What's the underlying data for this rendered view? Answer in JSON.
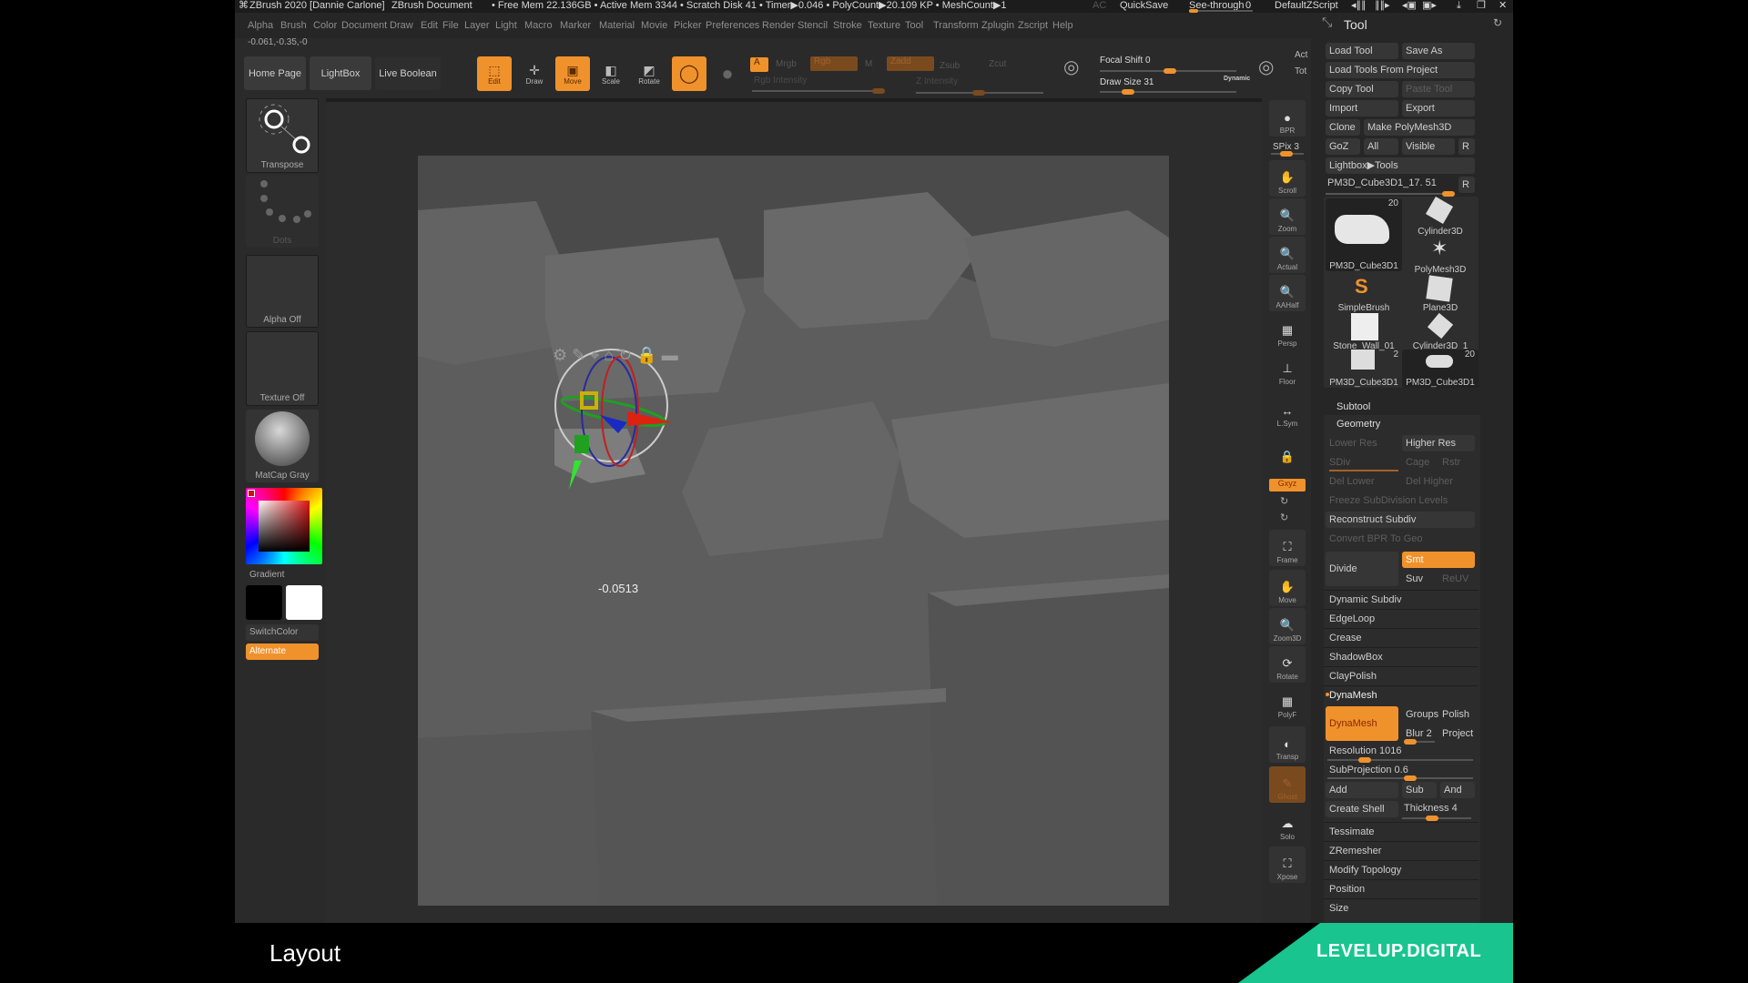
{
  "titlebar": {
    "app": "ZBrush 2020 [Dannie Carlone]",
    "document": "ZBrush Document",
    "stats": "• Free Mem 22.136GB • Active Mem 3344 • Scratch Disk 41 • Timer▶0.046 • PolyCount▶20.109 KP • MeshCount▶1",
    "ac": "AC",
    "quicksave": "QuickSave",
    "seethrough_label": "See-through",
    "seethrough_value": "0",
    "script": "DefaultZScript"
  },
  "menu": [
    "Alpha",
    "Brush",
    "Color",
    "Document",
    "Draw",
    "Edit",
    "File",
    "Layer",
    "Light",
    "Macro",
    "Marker",
    "Material",
    "Movie",
    "Picker",
    "Preferences",
    "Render",
    "Stencil",
    "Stroke",
    "Texture",
    "Tool",
    "Transform",
    "Zplugin",
    "Zscript",
    "Help"
  ],
  "coordinates": "-0.061,-0.35,-0",
  "shelf": {
    "nav": [
      "Home Page",
      "LightBox",
      "Live Boolean"
    ],
    "tools": [
      {
        "label": "Edit",
        "active": true,
        "icon": "edit-icon"
      },
      {
        "label": "Draw",
        "active": false,
        "icon": "draw-icon"
      },
      {
        "label": "Move",
        "active": true,
        "icon": "move-icon"
      },
      {
        "label": "Scale",
        "active": false,
        "icon": "scale-icon"
      },
      {
        "label": "Rotate",
        "active": false,
        "icon": "rotate-icon"
      }
    ],
    "a_label": "A",
    "mrgb": "Mrgb",
    "rgb": "Rgb",
    "m": "M",
    "zadd": "Zadd",
    "zsub": "Zsub",
    "zcut": "Zcut",
    "rgb_intensity": "Rgb Intensity",
    "z_intensity": "Z Intensity",
    "focal_shift": "Focal Shift 0",
    "draw_size": "Draw Size 31",
    "dynamic": "Dynamic",
    "act": "Act",
    "tot": "Tot"
  },
  "leftbar": {
    "brush": "Transpose",
    "stroke": "Dots",
    "alpha": "Alpha Off",
    "texture": "Texture Off",
    "material": "MatCap Gray",
    "gradient": "Gradient",
    "switchcolor": "SwitchColor",
    "alternate": "Alternate"
  },
  "viewport": {
    "gizmo_value": "-0.0513"
  },
  "rightshelf": [
    {
      "label": "BPR"
    },
    {
      "label": "SPix 3"
    },
    {
      "label": "Scroll"
    },
    {
      "label": "Zoom"
    },
    {
      "label": "Actual"
    },
    {
      "label": "AAHalf"
    },
    {
      "label": "Persp"
    },
    {
      "label": "Floor"
    },
    {
      "label": "L.Sym"
    },
    {
      "label": "Gxyz"
    },
    {
      "label": "Frame"
    },
    {
      "label": "Move"
    },
    {
      "label": "Zoom3D"
    },
    {
      "label": "Rotate"
    },
    {
      "label": "PolyF"
    },
    {
      "label": "Transp"
    },
    {
      "label": "Ghost"
    },
    {
      "label": "Solo"
    },
    {
      "label": "Xpose"
    }
  ],
  "tool": {
    "title": "Tool",
    "load_tool": "Load Tool",
    "save_as": "Save As",
    "load_tools_from_project": "Load Tools From Project",
    "copy_tool": "Copy Tool",
    "paste_tool": "Paste Tool",
    "import": "Import",
    "export": "Export",
    "clone": "Clone",
    "make_polymesh": "Make PolyMesh3D",
    "goz": "GoZ",
    "all": "All",
    "visible": "Visible",
    "r": "R",
    "lightbox_tools": "Lightbox▶Tools",
    "current_tool": "PM3D_Cube3D1_17. 51",
    "thumbs": [
      {
        "label": "PM3D_Cube3D1",
        "count": "20"
      },
      {
        "label": "Cylinder3D",
        "count": ""
      },
      {
        "label": "PolyMesh3D",
        "count": ""
      },
      {
        "label": "SimpleBrush",
        "count": ""
      },
      {
        "label": "Plane3D",
        "count": ""
      },
      {
        "label": "Stone_Wall_01",
        "count": ""
      },
      {
        "label": "Cylinder3D_1",
        "count": ""
      },
      {
        "label": "PM3D_Cube3D1",
        "count": "2"
      },
      {
        "label": "PM3D_Cube3D1",
        "count": "20"
      }
    ],
    "subtool": "Subtool",
    "geometry": "Geometry",
    "lower_res": "Lower Res",
    "higher_res": "Higher Res",
    "sdiv": "SDiv",
    "cage": "Cage",
    "rstr": "Rstr",
    "del_lower": "Del Lower",
    "del_higher": "Del Higher",
    "freeze": "Freeze SubDivision Levels",
    "reconstruct": "Reconstruct Subdiv",
    "convert_bpr": "Convert BPR To Geo",
    "divide": "Divide",
    "smt": "Smt",
    "suv": "Suv",
    "reuv": "ReUV",
    "sections": [
      "Dynamic Subdiv",
      "EdgeLoop",
      "Crease",
      "ShadowBox",
      "ClayPolish"
    ],
    "dynamesh_section": "DynaMesh",
    "dynamesh_btn": "DynaMesh",
    "groups": "Groups",
    "polish": "Polish",
    "blur": "Blur 2",
    "project": "Project",
    "resolution": "Resolution 1016",
    "subprojection": "SubProjection 0.6",
    "add": "Add",
    "sub": "Sub",
    "and": "And",
    "create_shell": "Create Shell",
    "thickness": "Thickness 4",
    "sections2": [
      "Tessimate",
      "ZRemesher",
      "Modify Topology",
      "Position",
      "Size"
    ]
  },
  "overlay": {
    "caption": "Layout",
    "brand": "LEVELUP.DIGITAL"
  },
  "colors": {
    "accent": "#f0922c",
    "brand": "#19c48f"
  }
}
